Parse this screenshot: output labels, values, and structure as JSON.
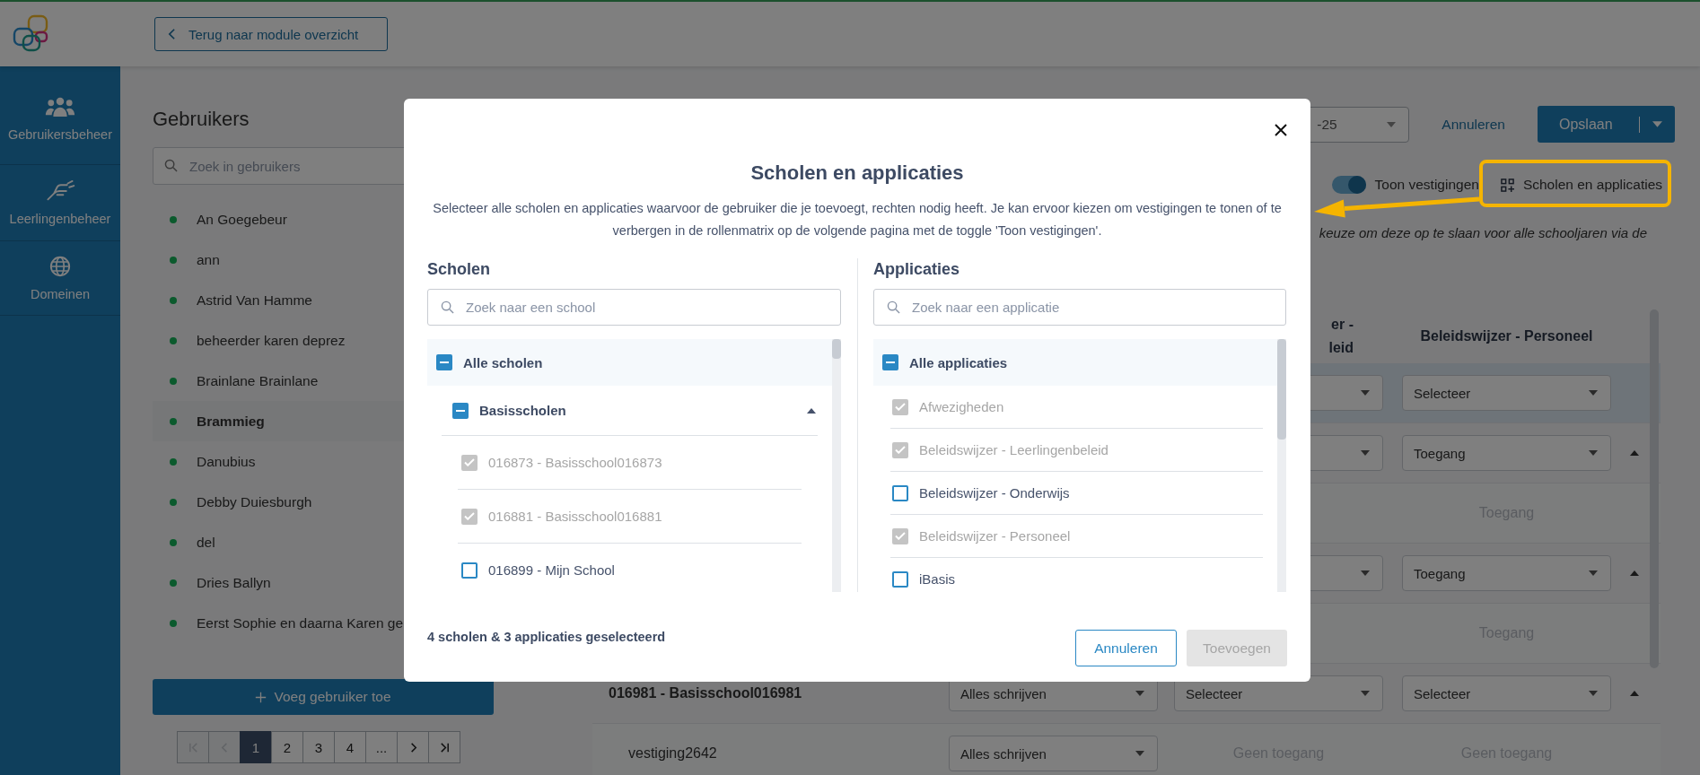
{
  "topbar": {
    "back_button": "Terug naar module overzicht"
  },
  "sidebar": {
    "items": [
      {
        "kind": "users",
        "label": "Gebruikersbeheer"
      },
      {
        "kind": "hand",
        "label": "Leerlingenbeheer"
      },
      {
        "kind": "globe",
        "label": "Domeinen"
      }
    ]
  },
  "users_panel": {
    "title": "Gebruikers",
    "search": {
      "placeholder": "Zoek in gebruikers"
    },
    "users": [
      {
        "name": "An Goegebeur",
        "selected": false
      },
      {
        "name": "ann",
        "selected": false
      },
      {
        "name": "Astrid Van Hamme",
        "selected": false
      },
      {
        "name": "beheerder karen deprez",
        "selected": false
      },
      {
        "name": "Brainlane Brainlane",
        "selected": false
      },
      {
        "name": "Brammieg",
        "selected": true
      },
      {
        "name": "Danubius",
        "selected": false
      },
      {
        "name": "Debby Duiesburgh",
        "selected": false
      },
      {
        "name": "del",
        "selected": false
      },
      {
        "name": "Dries Ballyn",
        "selected": false
      },
      {
        "name": "Eerst Sophie en daarna Karen ge",
        "selected": false
      }
    ],
    "add_button": "Voeg gebruiker toe",
    "pagination": [
      {
        "kind": "first",
        "disabled": true
      },
      {
        "kind": "prev",
        "disabled": true
      },
      {
        "kind": "page",
        "label": "1",
        "selected": true
      },
      {
        "kind": "page",
        "label": "2",
        "selected": false
      },
      {
        "kind": "page",
        "label": "3",
        "selected": false
      },
      {
        "kind": "page",
        "label": "4",
        "selected": false
      },
      {
        "kind": "more",
        "label": "...",
        "selected": false
      },
      {
        "kind": "next",
        "disabled": false
      },
      {
        "kind": "last",
        "disabled": false
      }
    ]
  },
  "toolbar": {
    "year_select": "-25",
    "cancel": "Annuleren",
    "save": "Opslaan",
    "show_branches": {
      "label": "Toon vestigingen",
      "on": true
    },
    "schools_button": "Scholen en applicaties",
    "note": "keuze om deze op te slaan voor alle schooljaren via de"
  },
  "matrix": {
    "headers": {
      "column_3": [
        "er -",
        "leid"
      ],
      "column_4": [
        "Beleidswijzer - Personeel"
      ]
    },
    "rows": [
      {
        "kind": "all",
        "highlighted": true,
        "expanded": false,
        "cells": {
          "column_3": {
            "kind": "select"
          },
          "column_4": {
            "kind": "select",
            "value": "Selecteer"
          }
        }
      },
      {
        "kind": "school",
        "highlighted": false,
        "expanded": true,
        "cells": {
          "column_3": {
            "kind": "select"
          },
          "column_4": {
            "kind": "select",
            "value": "Toegang"
          }
        }
      },
      {
        "kind": "branch",
        "highlighted": false,
        "expanded": false,
        "cells": {
          "column_4": {
            "kind": "text",
            "value": "Toegang"
          }
        }
      },
      {
        "kind": "school",
        "highlighted": false,
        "expanded": true,
        "cells": {
          "column_3": {
            "kind": "select"
          },
          "column_4": {
            "kind": "select",
            "value": "Toegang"
          }
        }
      },
      {
        "kind": "branch",
        "highlighted": false,
        "expanded": false,
        "cells": {
          "column_4": {
            "kind": "text",
            "value": "Toegang"
          }
        }
      },
      {
        "kind": "school",
        "name": "016981 - Basisschool016981",
        "highlighted": false,
        "expanded": true,
        "cells": {
          "column_2": {
            "kind": "select",
            "value": "Alles schrijven"
          },
          "column_3": {
            "kind": "select",
            "value": "Selecteer"
          },
          "column_4": {
            "kind": "select",
            "value": "Selecteer"
          }
        }
      },
      {
        "kind": "branch",
        "name": "vestiging2642",
        "highlighted": false,
        "expanded": false,
        "cells": {
          "column_2": {
            "kind": "select",
            "value": "Alles schrijven"
          },
          "column_3": {
            "kind": "text",
            "value": "Geen toegang"
          },
          "column_4": {
            "kind": "text",
            "value": "Geen toegang"
          }
        }
      }
    ]
  },
  "dialog": {
    "title": "Scholen en applicaties",
    "description": "Selecteer alle scholen en applicaties waarvoor de gebruiker die je toevoegt, rechten nodig heeft. Je kan ervoor kiezen om vestigingen te tonen of te verbergen in de rollenmatrix op de volgende pagina met de toggle 'Toon vestigingen'.",
    "schools": {
      "heading": "Scholen",
      "search": {
        "placeholder": "Zoek naar een school"
      },
      "all": {
        "label": "Alle scholen",
        "partial": true
      },
      "groups": [
        {
          "label": "Basisscholen",
          "partial": true,
          "expanded": true,
          "children": [
            {
              "label": "016873 - Basisschool016873",
              "checked": true,
              "disabled": true
            },
            {
              "label": "016881 - Basisschool016881",
              "checked": true,
              "disabled": true
            },
            {
              "label": "016899 - Mijn School",
              "checked": false,
              "disabled": false
            }
          ]
        }
      ]
    },
    "apps": {
      "heading": "Applicaties",
      "search": {
        "placeholder": "Zoek naar een applicatie"
      },
      "all": {
        "label": "Alle applicaties",
        "partial": true
      },
      "items": [
        {
          "label": "Afwezigheden",
          "checked": true,
          "disabled": true
        },
        {
          "label": "Beleidswijzer - Leerlingenbeleid",
          "checked": true,
          "disabled": true
        },
        {
          "label": "Beleidswijzer - Onderwijs",
          "checked": false,
          "disabled": false
        },
        {
          "label": "Beleidswijzer - Personeel",
          "checked": true,
          "disabled": true
        },
        {
          "label": "iBasis",
          "checked": false,
          "disabled": false
        }
      ]
    },
    "summary": "4 scholen & 3 applicaties geselecteerd",
    "cancel": "Annuleren",
    "submit": {
      "label": "Toevoegen",
      "disabled": true
    }
  }
}
